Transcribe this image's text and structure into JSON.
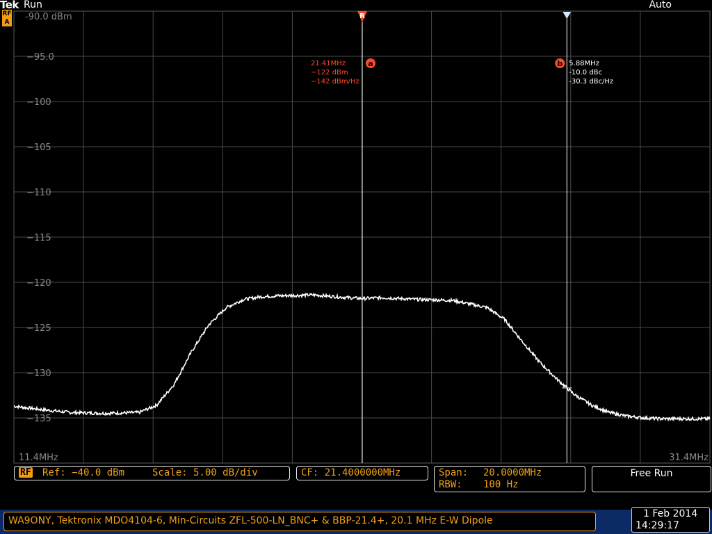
{
  "header": {
    "brand": "Tek",
    "run_state": "Run",
    "trigger_mode": "Auto",
    "rf_badge_top": "RF",
    "rf_badge_bottom": "A"
  },
  "chart_data": {
    "type": "line",
    "title": "",
    "xlabel": "",
    "ylabel": "",
    "y_unit": "dBm",
    "x_unit": "MHz",
    "xlim": [
      11.4,
      31.4
    ],
    "ylim": [
      -140.0,
      -90.0
    ],
    "y_tick_labels": [
      "-90.0 dBm",
      "−95.0",
      "−100",
      "−105",
      "−110",
      "−115",
      "−120",
      "−125",
      "−130",
      "−135"
    ],
    "x_start_label": "11.4MHz",
    "x_end_label": "31.4MHz",
    "grid": true,
    "series": [
      {
        "x": [
          11.4,
          12.0,
          13.0,
          14.0,
          15.0,
          15.5,
          16.0,
          16.5,
          17.0,
          17.5,
          18.0,
          18.5,
          19.0,
          20.0,
          21.0,
          21.41,
          22.0,
          23.0,
          24.0,
          25.0,
          25.5,
          26.0,
          26.5,
          27.0,
          27.5,
          28.0,
          28.5,
          29.0,
          29.5,
          30.0,
          31.0,
          31.4
        ],
        "y": [
          -133.7,
          -134.0,
          -134.4,
          -134.5,
          -134.4,
          -133.6,
          -131.3,
          -127.7,
          -124.7,
          -122.8,
          -121.9,
          -121.6,
          -121.5,
          -121.4,
          -121.7,
          -121.8,
          -121.7,
          -121.9,
          -122.0,
          -122.8,
          -124.1,
          -126.5,
          -128.8,
          -130.7,
          -132.4,
          -133.6,
          -134.4,
          -134.8,
          -135.0,
          -135.1,
          -135.1,
          -135.1
        ]
      }
    ]
  },
  "markers": {
    "ref_letter": "R",
    "a": {
      "letter": "a",
      "freq": "21.41MHz",
      "power": "−122 dBm",
      "density": "−142 dBm/Hz",
      "x_mhz": 21.41
    },
    "b": {
      "letter": "b",
      "freq": "5.88MHz",
      "power": "-10.0 dBc",
      "density": "-30.3 dBc/Hz",
      "x_mhz": 27.29
    }
  },
  "status": {
    "rf_label": "RF",
    "ref": "Ref: −40.0 dBm",
    "scale": "Scale: 5.00 dB/div",
    "cf": "CF: 21.4000000MHz",
    "span_label": "Span:",
    "span_value": "20.0000MHz",
    "rbw_label": "RBW:",
    "rbw_value": "100 Hz",
    "acq_mode": "Free Run"
  },
  "footer": {
    "caption": "WA9ONY, Tektronix MDO4104-6, Min-Circuits ZFL-500-LN_BNC+ & BBP-21.4+, 20.1 MHz E-W Dipole",
    "date": "1 Feb  2014",
    "time": "14:29:17"
  },
  "colors": {
    "trace": "#ffffff",
    "grid": "#5a5a5a",
    "marker_a": "#ff4a2a",
    "accent": "#f0a018",
    "footer_bg": "#0b2a66"
  }
}
